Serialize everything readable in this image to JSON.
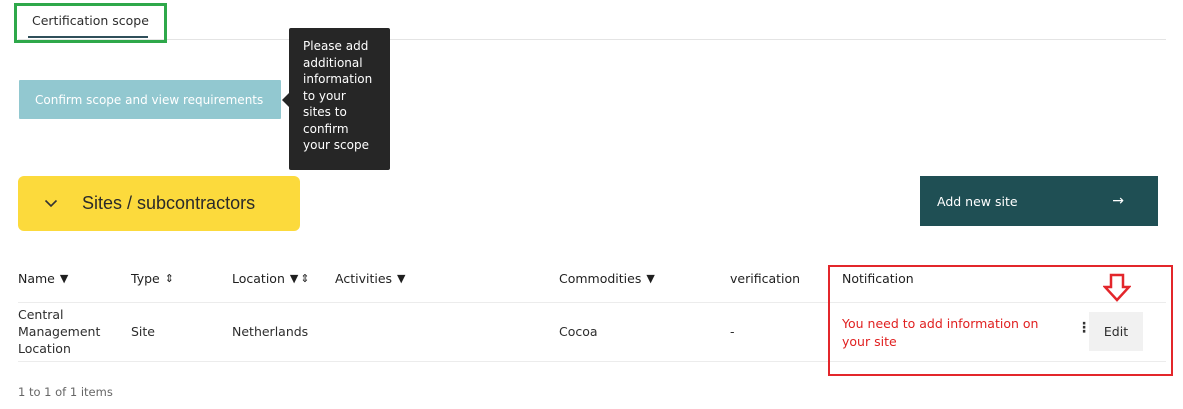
{
  "tabs": [
    {
      "label": "Certification scope"
    }
  ],
  "actions": {
    "confirm_label": "Confirm scope and view requirements",
    "add_site_label": "Add new site",
    "add_site_arrow": "→"
  },
  "tooltip": {
    "lines": [
      "Please add",
      "additional",
      "information",
      "to your",
      "sites to",
      "confirm",
      "your scope"
    ]
  },
  "section": {
    "title": "Sites / subcontractors"
  },
  "table": {
    "columns": [
      "Name",
      "Type",
      "Location",
      "Activities",
      "Commodities",
      "verification",
      "Notification"
    ],
    "rows": [
      {
        "name_lines": [
          "Central",
          "Management",
          "Location"
        ],
        "type": "Site",
        "location": "Netherlands",
        "activities": "",
        "commodities": "Cocoa",
        "verification": "-",
        "notification": "You need to add information on your site",
        "edit_label": "Edit"
      }
    ],
    "pager": "1 to 1 of 1 items"
  },
  "colors": {
    "accent_teal_dark": "#1f4f54",
    "confirm_button": "#92c8d0",
    "section_yellow": "#fcda3c",
    "highlight_green": "#2ea84a",
    "highlight_red": "#e3262b",
    "notification_text": "#e02020"
  }
}
